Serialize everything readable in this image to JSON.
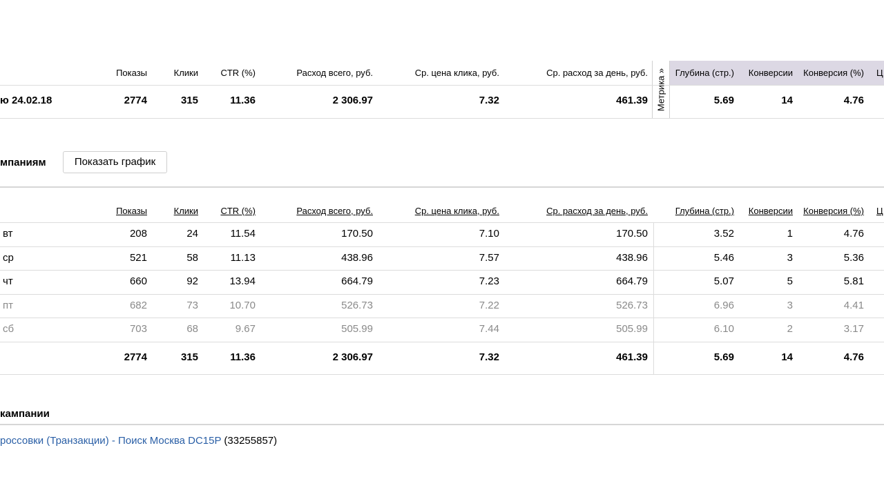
{
  "summary": {
    "headers": [
      "Показы",
      "Клики",
      "CTR (%)",
      "Расход всего, руб.",
      "Ср. цена клика, руб.",
      "Ср. расход за день, руб."
    ],
    "metrika_headers": [
      "Глубина (стр.)",
      "Конверсии",
      "Конверсия (%)",
      "Ц"
    ],
    "metrika_tab": "Метрика »",
    "row": {
      "label": "ю 24.02.18",
      "values": [
        "2774",
        "315",
        "11.36",
        "2 306.97",
        "7.32",
        "461.39"
      ],
      "metrika": [
        "5.69",
        "14",
        "4.76"
      ]
    }
  },
  "campaigns": {
    "section_title": "мпаниям",
    "show_chart_button": "Показать график",
    "headers": [
      "Показы",
      "Клики",
      "CTR (%)",
      "Расход всего, руб.",
      "Ср. цена клика, руб.",
      "Ср. расход за день, руб."
    ],
    "metrika_headers": [
      "Глубина (стр.)",
      "Конверсии",
      "Конверсия (%)",
      "Ц"
    ],
    "rows": [
      {
        "label": "вт",
        "values": [
          "208",
          "24",
          "11.54",
          "170.50",
          "7.10",
          "170.50"
        ],
        "metrika": [
          "3.52",
          "1",
          "4.76"
        ],
        "muted": false
      },
      {
        "label": "ср",
        "values": [
          "521",
          "58",
          "11.13",
          "438.96",
          "7.57",
          "438.96"
        ],
        "metrika": [
          "5.46",
          "3",
          "5.36"
        ],
        "muted": false
      },
      {
        "label": "чт",
        "values": [
          "660",
          "92",
          "13.94",
          "664.79",
          "7.23",
          "664.79"
        ],
        "metrika": [
          "5.07",
          "5",
          "5.81"
        ],
        "muted": false
      },
      {
        "label": "пт",
        "values": [
          "682",
          "73",
          "10.70",
          "526.73",
          "7.22",
          "526.73"
        ],
        "metrika": [
          "6.96",
          "3",
          "4.41"
        ],
        "muted": true
      },
      {
        "label": "сб",
        "values": [
          "703",
          "68",
          "9.67",
          "505.99",
          "7.44",
          "505.99"
        ],
        "metrika": [
          "6.10",
          "2",
          "3.17"
        ],
        "muted": true
      }
    ],
    "total": {
      "values": [
        "2774",
        "315",
        "11.36",
        "2 306.97",
        "7.32",
        "461.39"
      ],
      "metrika": [
        "5.69",
        "14",
        "4.76"
      ]
    }
  },
  "campaign_list": {
    "section_title": "кампании",
    "link_text": "россовки (Транзакции) - Поиск Москва DC15P",
    "campaign_id": "(33255857)"
  }
}
